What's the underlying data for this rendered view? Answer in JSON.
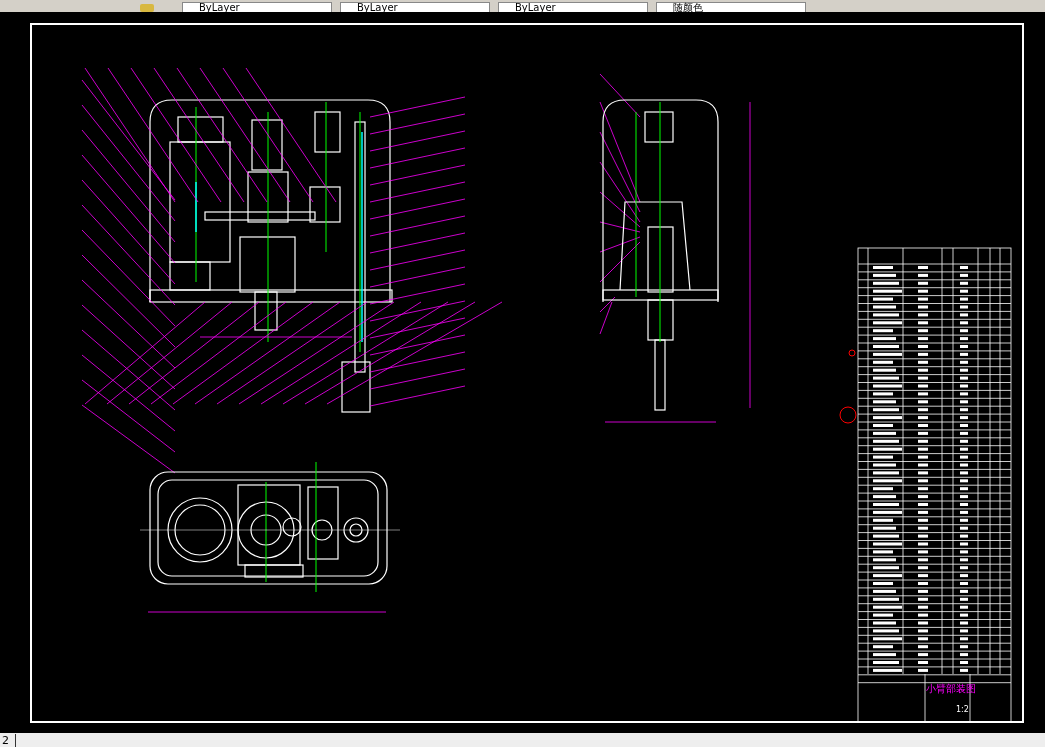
{
  "toolbar": {
    "dropdowns": [
      {
        "value": "ByLayer"
      },
      {
        "value": "ByLayer"
      },
      {
        "value": "ByLayer"
      },
      {
        "value": "随颜色"
      }
    ]
  },
  "title_block": {
    "title": "小臂部装图",
    "scale": "1:2"
  },
  "layout_tabs": [
    {
      "label": "2"
    }
  ]
}
